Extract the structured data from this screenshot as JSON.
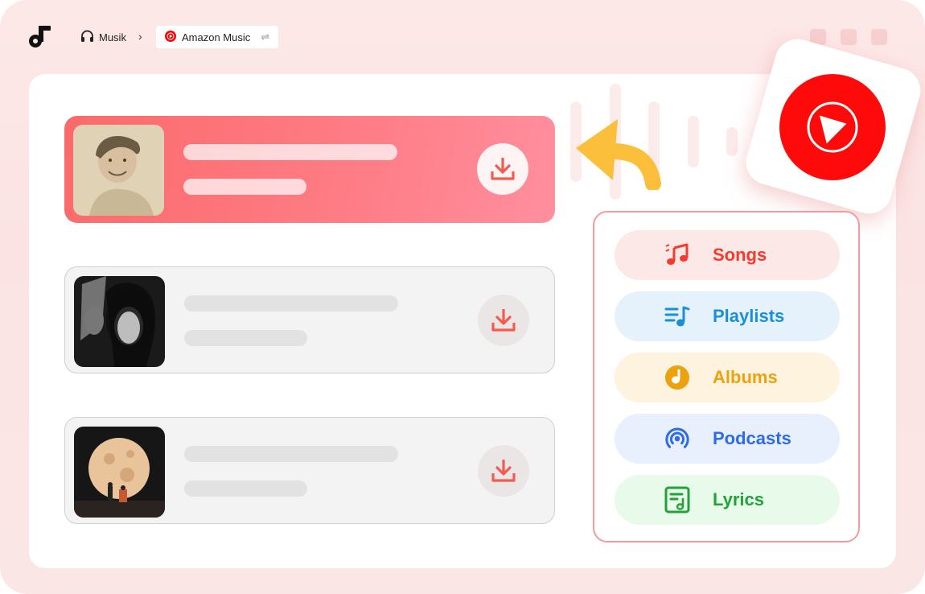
{
  "breadcrumb": {
    "home_label": "Musik",
    "current_label": "Amazon Music",
    "swap_symbol": "⇌"
  },
  "tracks": [
    {
      "state": "active",
      "cover": "portrait-man-sketch"
    },
    {
      "state": "idle",
      "cover": "portrait-woman-bw"
    },
    {
      "state": "idle",
      "cover": "moon-couple"
    }
  ],
  "categories": [
    {
      "label": "Songs",
      "icon": "music-notes-icon",
      "color": "#f53b2c",
      "bg": "#fde8e8"
    },
    {
      "label": "Playlists",
      "icon": "playlist-icon",
      "color": "#1a8fd9",
      "bg": "#e6f2fb"
    },
    {
      "label": "Albums",
      "icon": "album-disc-icon",
      "color": "#eba20e",
      "bg": "#fef3de"
    },
    {
      "label": "Podcasts",
      "icon": "podcast-icon",
      "color": "#2f6be3",
      "bg": "#e8effd"
    },
    {
      "label": "Lyrics",
      "icon": "lyrics-icon",
      "color": "#23a23a",
      "bg": "#e8faea"
    }
  ],
  "colors": {
    "accent": "#fb6a6a",
    "youtube_red": "#ff0a0a",
    "arrow_orange": "#fbbf3c"
  }
}
